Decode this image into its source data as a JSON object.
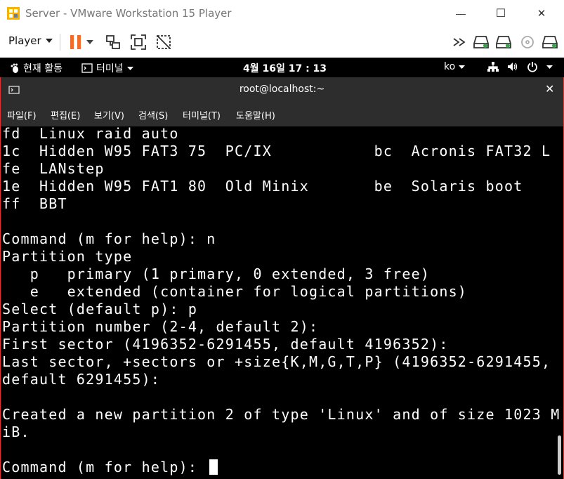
{
  "window": {
    "title": "Server - VMware Workstation 15 Player",
    "minimize_glyph": "—",
    "maximize_glyph": "☐",
    "close_glyph": "✕"
  },
  "toolbar": {
    "player_label": "Player",
    "icons": [
      "pause-icon",
      "send-ctrl-alt-del-icon",
      "fit-guest-icon",
      "unity-icon",
      "forward-icon",
      "hard-disk-icon",
      "network-icon",
      "cd-icon",
      "usb-icon"
    ]
  },
  "gnome": {
    "activities": "현재 활동",
    "terminal_menu": "터미널",
    "clock": "4월 16일  17 : 13",
    "input_method": "ko"
  },
  "terminal": {
    "title": "root@localhost:~",
    "menu": [
      "파일(F)",
      "편집(E)",
      "보기(V)",
      "검색(S)",
      "터미널(T)",
      "도움말(H)"
    ],
    "lines": [
      "fd  Linux raid auto",
      "1c  Hidden W95 FAT3 75  PC/IX           bc  Acronis FAT32 L",
      "fe  LANstep",
      "1e  Hidden W95 FAT1 80  Old Minix       be  Solaris boot",
      "ff  BBT",
      "",
      "Command (m for help): n",
      "Partition type",
      "   p   primary (1 primary, 0 extended, 3 free)",
      "   e   extended (container for logical partitions)",
      "Select (default p): p",
      "Partition number (2-4, default 2):",
      "First sector (4196352-6291455, default 4196352):",
      "Last sector, +sectors or +size{K,M,G,T,P} (4196352-6291455,",
      "default 6291455):",
      "",
      "Created a new partition 2 of type 'Linux' and of size 1023 M",
      "iB.",
      "",
      "Command (m for help): "
    ]
  }
}
